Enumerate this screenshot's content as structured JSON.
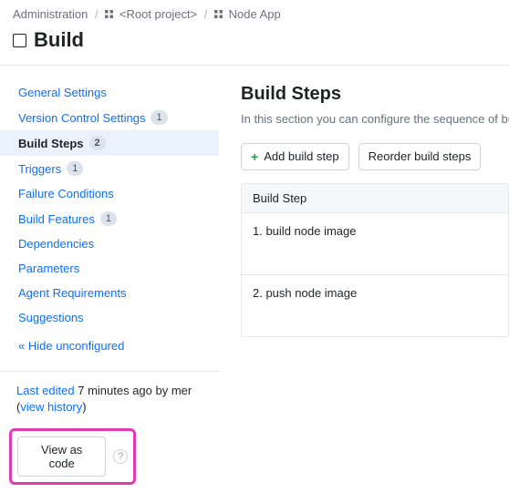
{
  "breadcrumb": {
    "admin": "Administration",
    "root": "<Root project>",
    "node": "Node App"
  },
  "page_title": "Build",
  "sidebar": {
    "items": [
      {
        "label": "General Settings",
        "badge": null,
        "active": false
      },
      {
        "label": "Version Control Settings",
        "badge": "1",
        "active": false
      },
      {
        "label": "Build Steps",
        "badge": "2",
        "active": true
      },
      {
        "label": "Triggers",
        "badge": "1",
        "active": false
      },
      {
        "label": "Failure Conditions",
        "badge": null,
        "active": false
      },
      {
        "label": "Build Features",
        "badge": "1",
        "active": false
      },
      {
        "label": "Dependencies",
        "badge": null,
        "active": false
      },
      {
        "label": "Parameters",
        "badge": null,
        "active": false
      },
      {
        "label": "Agent Requirements",
        "badge": null,
        "active": false
      },
      {
        "label": "Suggestions",
        "badge": null,
        "active": false
      }
    ],
    "hide_unconfigured": "« Hide unconfigured"
  },
  "edited": {
    "prefix": "Last edited",
    "time": "7 minutes ago by mer",
    "view_history": "view history"
  },
  "view_as_code": "View as code",
  "main": {
    "heading": "Build Steps",
    "desc": "In this section you can configure the sequence of build steps to be executed. Each build step is represented by a build runner and provides integration with a specific build or test tool.",
    "add_label": "Add build step",
    "reorder_label": "Reorder build steps",
    "column": "Build Step",
    "steps": [
      {
        "label": "1. build node image"
      },
      {
        "label": "2. push node image"
      }
    ]
  }
}
